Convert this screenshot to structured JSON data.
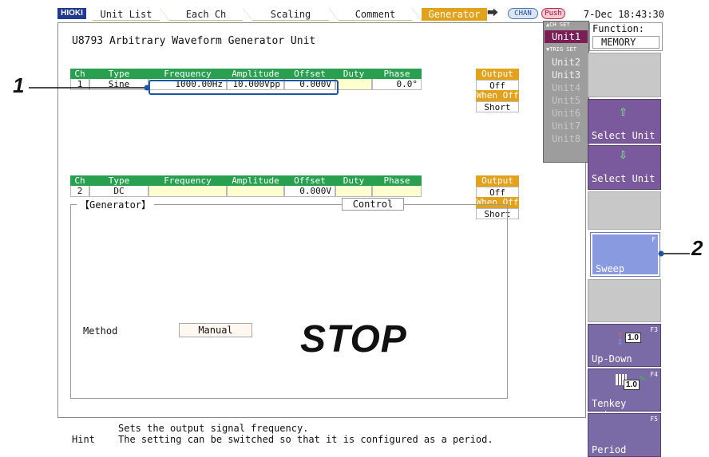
{
  "topbar": {
    "logo": "HIOKI",
    "tabs": [
      "Unit List",
      "Each Ch",
      "Scaling",
      "Comment",
      "Generator"
    ],
    "active_tab": "Generator",
    "chan": "CHAN",
    "push": "Push",
    "clock": "7-Dec 18:43:30"
  },
  "title": "U8793  Arbitrary Waveform Generator Unit",
  "table1": {
    "headers": [
      "Ch",
      "Type",
      "Frequency",
      "Amplitude",
      "Offset",
      "Duty",
      "Phase"
    ],
    "row": {
      "ch": "1",
      "type": "Sine",
      "frequency": "1000.00Hz",
      "amplitude": "10.000Vpp",
      "offset": "0.000V",
      "duty": "",
      "phase": "0.0°"
    }
  },
  "table2": {
    "headers": [
      "Ch",
      "Type",
      "Frequency",
      "Amplitude",
      "Offset",
      "Duty",
      "Phase"
    ],
    "row": {
      "ch": "2",
      "type": "DC",
      "frequency": "",
      "amplitude": "",
      "offset": "0.000V",
      "duty": "",
      "phase": ""
    }
  },
  "output1": {
    "output_label": "Output",
    "output_val": "Off",
    "when_off_label": "When Off",
    "when_off_val": "Short"
  },
  "output2": {
    "output_label": "Output",
    "output_val": "Off",
    "when_off_label": "When Off",
    "when_off_val": "Short"
  },
  "callouts": {
    "one": "1",
    "two": "2"
  },
  "generator": {
    "section_label": "【Generator】",
    "control_label": "Control",
    "method_label": "Method",
    "method_value": "Manual",
    "state": "STOP"
  },
  "hint": {
    "label": "Hint",
    "line1": "Sets the output signal frequency.",
    "line2": "The setting can be switched so that it is configured as a period."
  },
  "units": {
    "ch_set": "▲CH SET",
    "trig_set": "▼TRIG SET",
    "items": [
      "Unit1",
      "Unit2",
      "Unit3",
      "Unit4",
      "Unit5",
      "Unit6",
      "Unit7",
      "Unit8"
    ]
  },
  "function": {
    "label": "Function:",
    "value": "MEMORY"
  },
  "softkeys": {
    "select_up": "Select Unit",
    "select_down": "Select Unit",
    "sweep": "Sweep",
    "sweep_key": "F",
    "updown": "Up-Down",
    "updown_key": "F3",
    "tenkey": "Tenkey entry",
    "tenkey_key": "F4",
    "period": "Period",
    "period_key": "F5",
    "icon_value": "1.0"
  }
}
